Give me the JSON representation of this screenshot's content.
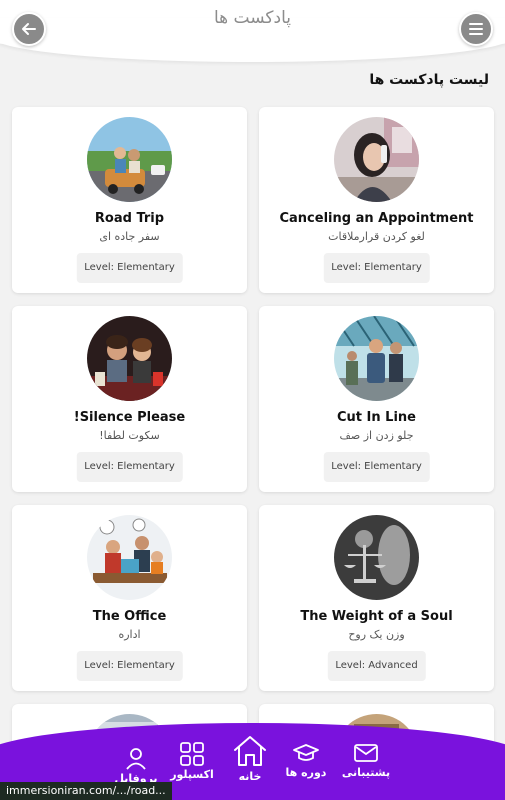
{
  "header": {
    "title": "پادکست ها",
    "back_icon": "arrow-left-icon",
    "menu_icon": "hamburger-menu-icon"
  },
  "section": {
    "title": "لیست پادکست ها"
  },
  "podcasts": [
    {
      "title": "Canceling an Appointment",
      "subtitle": "لغو کردن قرارملاقات",
      "level": "Level: Elementary"
    },
    {
      "title": "Road Trip",
      "subtitle": "سفر جاده ای",
      "level": "Level: Elementary"
    },
    {
      "title": "Cut In Line",
      "subtitle": "جلو زدن از صف",
      "level": "Level: Elementary"
    },
    {
      "title": "!Silence Please",
      "subtitle": "سکوت لطفا!",
      "level": "Level: Elementary"
    },
    {
      "title": "The Weight of a Soul",
      "subtitle": "وزن یک روح",
      "level": "Level: Advanced"
    },
    {
      "title": "The Office",
      "subtitle": "اداره",
      "level": "Level: Elementary"
    }
  ],
  "nav": {
    "support": "پشتیبانی",
    "courses": "دوره ها",
    "home": "خانه",
    "explore": "اکسپلور",
    "profile": "پروفایل"
  },
  "status_url": "immersioniran.com/.../road...",
  "colors": {
    "nav_bg": "#7a12dd",
    "header_button": "#8a8a8a",
    "page_bg": "#f2f2f2"
  }
}
